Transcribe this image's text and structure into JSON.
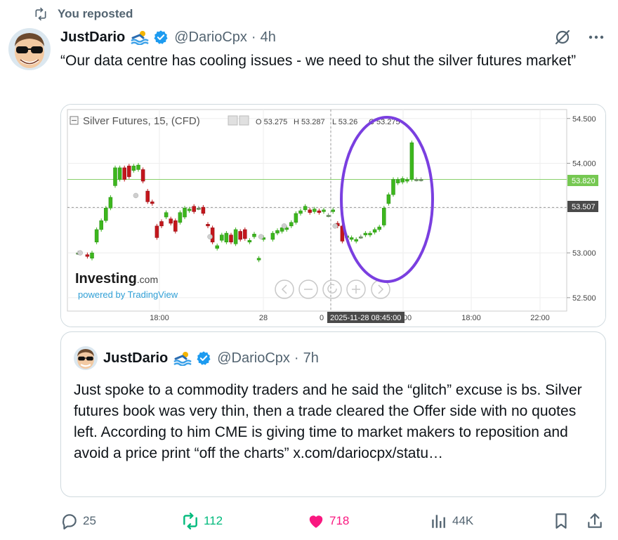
{
  "repost": {
    "label": "You reposted"
  },
  "tweet": {
    "author_name": "JustDario",
    "handle": "@DarioCpx",
    "separator": "·",
    "time": "4h",
    "text": "“Our data centre has cooling issues - we need to shut the silver futures market”"
  },
  "chart": {
    "title": "Silver Futures, 15, (CFD)",
    "ohlc": {
      "o": "O 53.275",
      "h": "H 53.287",
      "l": "L 53.26",
      "c": "C 53.275"
    },
    "brand": "Investing",
    "brand_suffix": ".com",
    "powered": "powered by TradingView",
    "current_price_label": "53.820",
    "crosshair_price_label": "53.507",
    "crosshair_time_label": "2025-11-28 08:45:00",
    "colors": {
      "up": "#3cb71d",
      "down": "#c4161c",
      "circle": "#7a3fe0",
      "price_line": "#8ad06c"
    }
  },
  "chart_data": {
    "type": "candlestick",
    "title": "Silver Futures, 15, (CFD)",
    "xlabels": [
      "18:00",
      "28",
      "0",
      "00",
      "18:00",
      "22:00"
    ],
    "ylabels": [
      "54.500",
      "54.000",
      "53.000",
      "52.500"
    ],
    "ylim": [
      52.35,
      54.6
    ],
    "grid": true,
    "candles": [
      {
        "x": 2,
        "o": 53.0,
        "c": 53.0
      },
      {
        "x": 4,
        "o": 52.98,
        "c": 52.96
      },
      {
        "x": 5,
        "o": 52.94,
        "c": 53.0
      },
      {
        "x": 6,
        "o": 53.12,
        "c": 53.26
      },
      {
        "x": 7,
        "o": 53.26,
        "c": 53.36
      },
      {
        "x": 8,
        "o": 53.36,
        "c": 53.5
      },
      {
        "x": 9,
        "o": 53.5,
        "c": 53.62
      },
      {
        "x": 10,
        "o": 53.75,
        "c": 53.95
      },
      {
        "x": 11,
        "o": 53.82,
        "c": 53.95
      },
      {
        "x": 12,
        "o": 53.95,
        "c": 53.82
      },
      {
        "x": 13,
        "o": 53.97,
        "c": 53.85
      },
      {
        "x": 14,
        "o": 53.92,
        "c": 53.97
      },
      {
        "x": 15,
        "o": 53.93,
        "c": 53.98
      },
      {
        "x": 16,
        "o": 53.93,
        "c": 53.8
      },
      {
        "x": 17,
        "o": 53.69,
        "c": 53.57
      },
      {
        "x": 18,
        "o": 53.57,
        "c": 53.55
      },
      {
        "x": 19,
        "o": 53.3,
        "c": 53.17
      },
      {
        "x": 20,
        "o": 53.35,
        "c": 53.3
      },
      {
        "x": 21,
        "o": 53.4,
        "c": 53.45
      },
      {
        "x": 22,
        "o": 53.38,
        "c": 53.33
      },
      {
        "x": 23,
        "o": 53.36,
        "c": 53.24
      },
      {
        "x": 24,
        "o": 53.34,
        "c": 53.45
      },
      {
        "x": 25,
        "o": 53.4,
        "c": 53.5
      },
      {
        "x": 26,
        "o": 53.47,
        "c": 53.49
      },
      {
        "x": 27,
        "o": 53.52,
        "c": 53.46
      },
      {
        "x": 28,
        "o": 53.5,
        "c": 53.5
      },
      {
        "x": 29,
        "o": 53.51,
        "c": 53.44
      },
      {
        "x": 30,
        "o": 53.32,
        "c": 53.3
      },
      {
        "x": 31,
        "o": 53.28,
        "c": 53.12
      },
      {
        "x": 32,
        "o": 53.05,
        "c": 53.08
      },
      {
        "x": 33,
        "o": 53.14,
        "c": 53.2
      },
      {
        "x": 34,
        "o": 53.12,
        "c": 53.22
      },
      {
        "x": 35,
        "o": 53.2,
        "c": 53.12
      },
      {
        "x": 36,
        "o": 53.1,
        "c": 53.26
      },
      {
        "x": 37,
        "o": 53.24,
        "c": 53.15
      },
      {
        "x": 38,
        "o": 53.26,
        "c": 53.16
      },
      {
        "x": 39,
        "o": 53.12,
        "c": 53.14
      },
      {
        "x": 40,
        "o": 53.18,
        "c": 53.21
      },
      {
        "x": 41,
        "o": 52.92,
        "c": 52.94
      },
      {
        "x": 42,
        "o": 53.15,
        "c": 53.17
      },
      {
        "x": 44,
        "o": 53.15,
        "c": 53.22
      },
      {
        "x": 45,
        "o": 53.22,
        "c": 53.25
      },
      {
        "x": 46,
        "o": 53.24,
        "c": 53.28
      },
      {
        "x": 47,
        "o": 53.26,
        "c": 53.28
      },
      {
        "x": 48,
        "o": 53.3,
        "c": 53.34
      },
      {
        "x": 49,
        "o": 53.34,
        "c": 53.44
      },
      {
        "x": 50,
        "o": 53.44,
        "c": 53.47
      },
      {
        "x": 51,
        "o": 53.48,
        "c": 53.52
      },
      {
        "x": 52,
        "o": 53.48,
        "c": 53.45
      },
      {
        "x": 53,
        "o": 53.46,
        "c": 53.49
      },
      {
        "x": 54,
        "o": 53.47,
        "c": 53.45
      },
      {
        "x": 55,
        "o": 53.46,
        "c": 53.48
      },
      {
        "x": 56,
        "o": 53.42,
        "c": 53.42
      },
      {
        "x": 57,
        "o": 53.46,
        "c": 53.48
      },
      {
        "x": 58,
        "o": 53.33,
        "c": 53.3
      },
      {
        "x": 59,
        "o": 53.3,
        "c": 53.13
      },
      {
        "x": 60,
        "o": 53.17,
        "c": 53.19
      },
      {
        "x": 61,
        "o": 53.15,
        "c": 53.17
      },
      {
        "x": 62,
        "o": 53.13,
        "c": 53.15
      },
      {
        "x": 63,
        "o": 53.18,
        "c": 53.18
      },
      {
        "x": 64,
        "o": 53.2,
        "c": 53.22
      },
      {
        "x": 65,
        "o": 53.2,
        "c": 53.22
      },
      {
        "x": 66,
        "o": 53.23,
        "c": 53.26
      },
      {
        "x": 67,
        "o": 53.26,
        "c": 53.29
      },
      {
        "x": 68,
        "o": 53.31,
        "c": 53.5
      },
      {
        "x": 69,
        "o": 53.55,
        "c": 53.65
      },
      {
        "x": 70,
        "o": 53.65,
        "c": 53.82
      },
      {
        "x": 71,
        "o": 53.78,
        "c": 53.82
      },
      {
        "x": 72,
        "o": 53.79,
        "c": 53.83
      },
      {
        "x": 73,
        "o": 53.8,
        "c": 53.82
      },
      {
        "x": 74,
        "o": 53.82,
        "c": 54.23
      },
      {
        "x": 75,
        "o": 53.82,
        "c": 53.82
      },
      {
        "x": 76,
        "o": 53.82,
        "c": 53.82
      }
    ]
  },
  "quote": {
    "author_name": "JustDario",
    "handle": "@DarioCpx",
    "separator": "·",
    "time": "7h",
    "text": "Just spoke to a commodity traders and he said the “glitch” excuse is bs. Silver futures book was very thin, then a trade cleared the Offer side with no quotes left. According to him CME is giving time to market makers to reposition and avoid a price print “off the charts” x.com/dariocpx/statu…"
  },
  "actions": {
    "replies": "25",
    "reposts": "112",
    "likes": "718",
    "views": "44K"
  },
  "colors": {
    "repost_green": "#00ba7c",
    "like_pink": "#f91880",
    "muted": "#536471",
    "verified_blue": "#1d9bf0"
  }
}
